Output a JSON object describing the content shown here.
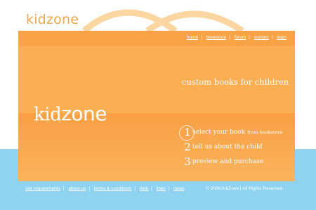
{
  "brand": {
    "logo_kid": "kid",
    "logo_zone": "zone"
  },
  "nav": [
    {
      "label": "home"
    },
    {
      "label": "bookstore"
    },
    {
      "label": "forum"
    },
    {
      "label": "contact"
    },
    {
      "label": "login"
    }
  ],
  "tagline": "custom books for children",
  "steps": [
    {
      "num": "1",
      "text": "select your book",
      "note": "from bookstore"
    },
    {
      "num": "2",
      "text": "tell us about the child",
      "note": ""
    },
    {
      "num": "3",
      "text": "preview and purchase",
      "note": ""
    }
  ],
  "footer": {
    "links": [
      {
        "label": "site requirements"
      },
      {
        "label": "about us"
      },
      {
        "label": "terms & conditions"
      },
      {
        "label": "help"
      },
      {
        "label": "links"
      },
      {
        "label": "news"
      }
    ],
    "copyright": "© 2006 KidZone  |  All Rights Reserved."
  },
  "colors": {
    "accent": "#f3a54c",
    "panel": "#fcae52",
    "sky": "#8fd3f0"
  }
}
